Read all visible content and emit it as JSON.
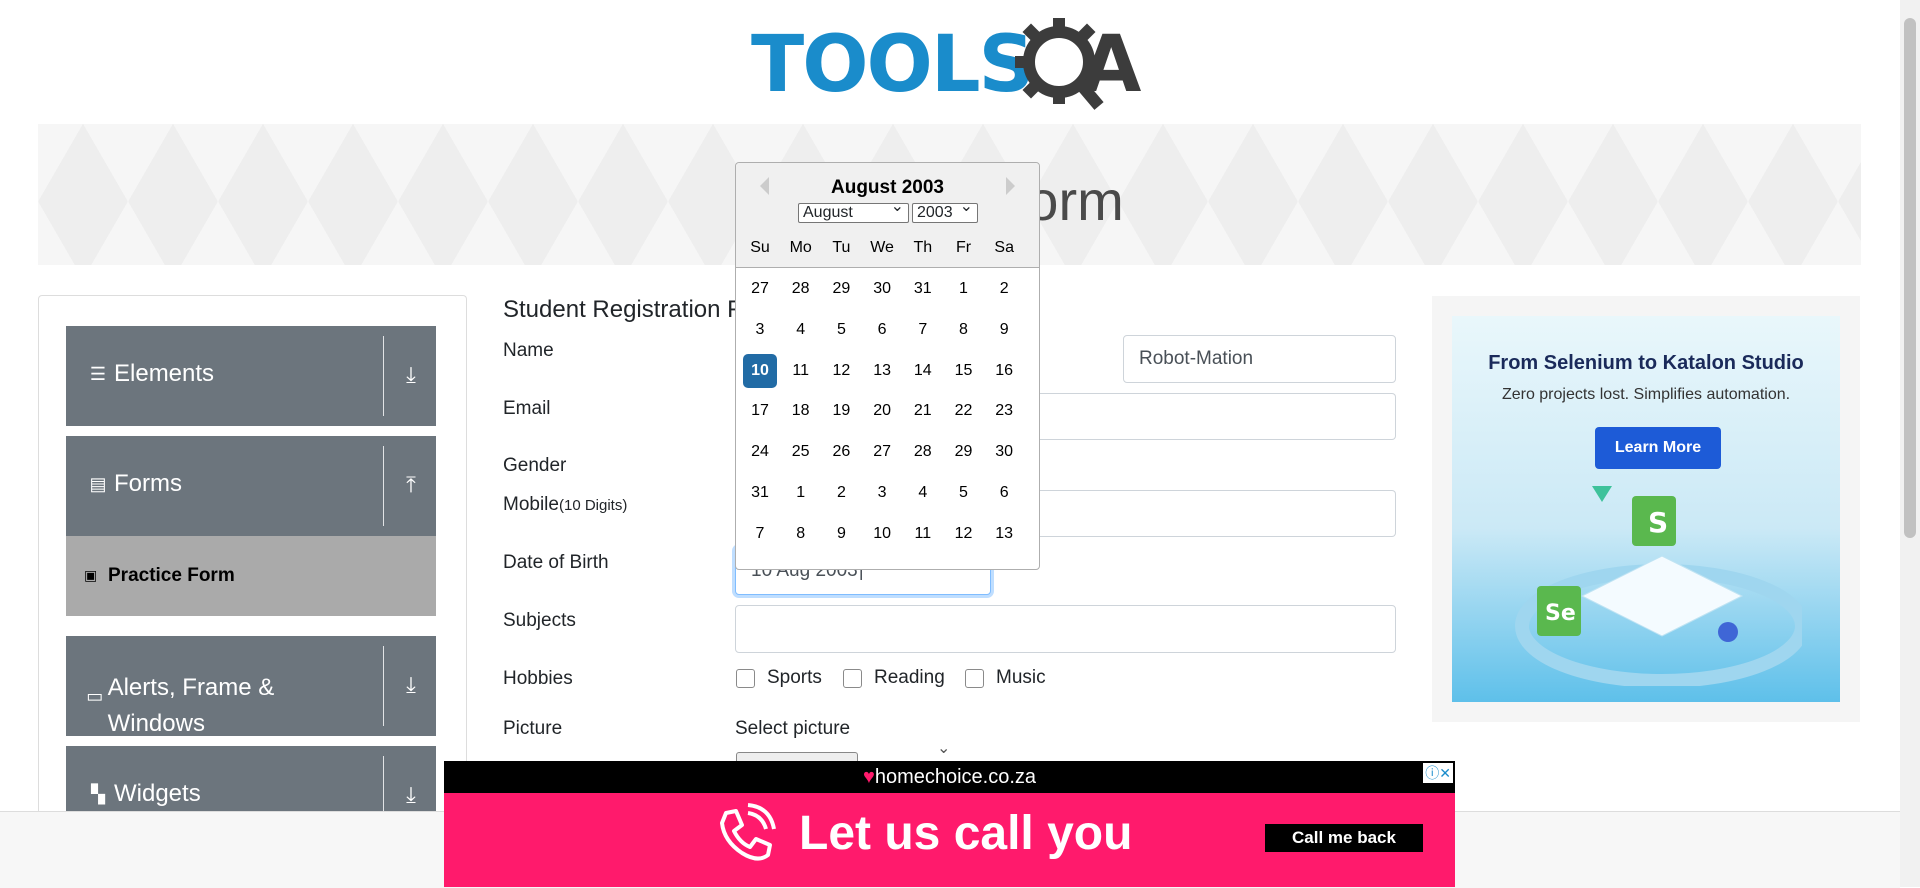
{
  "logo": {
    "text": "TOOLS",
    "suffix": "A"
  },
  "banner": {
    "title": "Practice Form"
  },
  "sidebar": {
    "groups": [
      {
        "label": "Elements",
        "icon": "hamburger-icon",
        "arrow": "download-arrow-icon"
      },
      {
        "label": "Forms",
        "icon": "document-icon",
        "arrow": "upload-arrow-icon"
      },
      {
        "label": "Alerts, Frame & Windows",
        "icon": "window-icon",
        "arrow": "download-arrow-icon"
      },
      {
        "label": "Widgets",
        "icon": "widgets-icon",
        "arrow": "download-arrow-icon"
      }
    ],
    "active_item": "Practice Form"
  },
  "form": {
    "title": "Student Registration Form",
    "labels": {
      "name": "Name",
      "email": "Email",
      "gender": "Gender",
      "mobile": "Mobile",
      "mobile_hint": "(10 Digits)",
      "dob": "Date of Birth",
      "subjects": "Subjects",
      "hobbies": "Hobbies",
      "picture": "Picture"
    },
    "last_name_value": "Robot-Mation",
    "dob_value": "10 Aug 2003",
    "hobbies": [
      "Sports",
      "Reading",
      "Music"
    ],
    "picture_label": "Select picture"
  },
  "datepicker": {
    "title": "August 2003",
    "month_select": "August",
    "year_select": "2003",
    "weekdays": [
      "Su",
      "Mo",
      "Tu",
      "We",
      "Th",
      "Fr",
      "Sa"
    ],
    "weeks": [
      [
        "27",
        "28",
        "29",
        "30",
        "31",
        "1",
        "2"
      ],
      [
        "3",
        "4",
        "5",
        "6",
        "7",
        "8",
        "9"
      ],
      [
        "10",
        "11",
        "12",
        "13",
        "14",
        "15",
        "16"
      ],
      [
        "17",
        "18",
        "19",
        "20",
        "21",
        "22",
        "23"
      ],
      [
        "24",
        "25",
        "26",
        "27",
        "28",
        "29",
        "30"
      ],
      [
        "31",
        "1",
        "2",
        "3",
        "4",
        "5",
        "6"
      ],
      [
        "7",
        "8",
        "9",
        "10",
        "11",
        "12",
        "13"
      ]
    ],
    "selected": "10"
  },
  "ad_right": {
    "title": "From Selenium to Katalon Studio",
    "subtitle": "Zero projects lost. Simplifies automation.",
    "button": "Learn More"
  },
  "ad_bottom": {
    "brand": "homechoice.co.za",
    "headline": "Let us call you",
    "button": "Call me back"
  }
}
